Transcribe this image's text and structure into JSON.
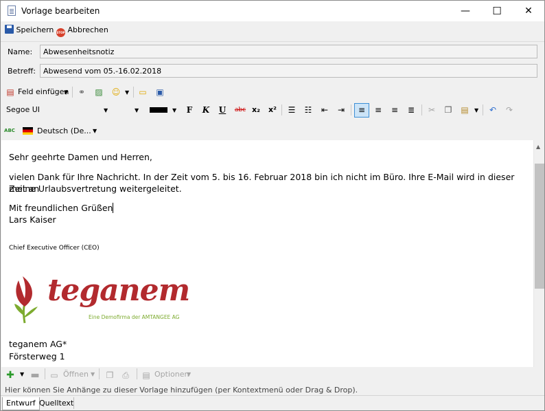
{
  "window": {
    "title": "Vorlage bearbeiten",
    "minimize": "—",
    "maximize": "☐",
    "close": "✕"
  },
  "actions": {
    "save": "Speichern",
    "cancel": "Abbrechen"
  },
  "form": {
    "name_label": "Name:",
    "name_value": "Abwesenheitsnotiz",
    "subject_label": "Betreff:",
    "subject_value": "Abwesend vom 05.-16.02.2018"
  },
  "toolbar1": {
    "insert_field": "Feld einfügen"
  },
  "toolbar2": {
    "font": "Segoe UI",
    "bold": "F",
    "italic": "K",
    "underline": "U",
    "strike": "abc",
    "sub": "x₂",
    "sup": "x²"
  },
  "toolbar3": {
    "language": "Deutsch (De..."
  },
  "body": {
    "greeting": "Sehr geehrte Damen und Herren,",
    "para1_line1": "vielen Dank für Ihre Nachricht. In der Zeit vom 5. bis 16. Februar 2018 bin ich nicht im Büro. Ihre E-Mail wird in dieser Zeit an",
    "para1_line2": "meine Urlaubsvertretung weitergeleitet.",
    "closing": "Mit freundlichen Grüßen",
    "name": "Lars Kaiser",
    "role": "Chief Executive Officer (CEO)",
    "logo_text": "teganem",
    "logo_tagline": "Eine Demofirma der AMTANGEE AG",
    "company": "teganem AG*",
    "street": "Försterweg 1"
  },
  "attachments": {
    "open": "Öffnen",
    "options": "Optionen",
    "hint": "Hier können Sie Anhänge zu dieser Vorlage hinzufügen (per Kontextmenü oder Drag & Drop)."
  },
  "tabs": [
    "Entwurf",
    "Quelltext"
  ],
  "colors": {
    "logo_red": "#b22a2e",
    "logo_green": "#7dab2f",
    "accent": "#cce4f7"
  }
}
